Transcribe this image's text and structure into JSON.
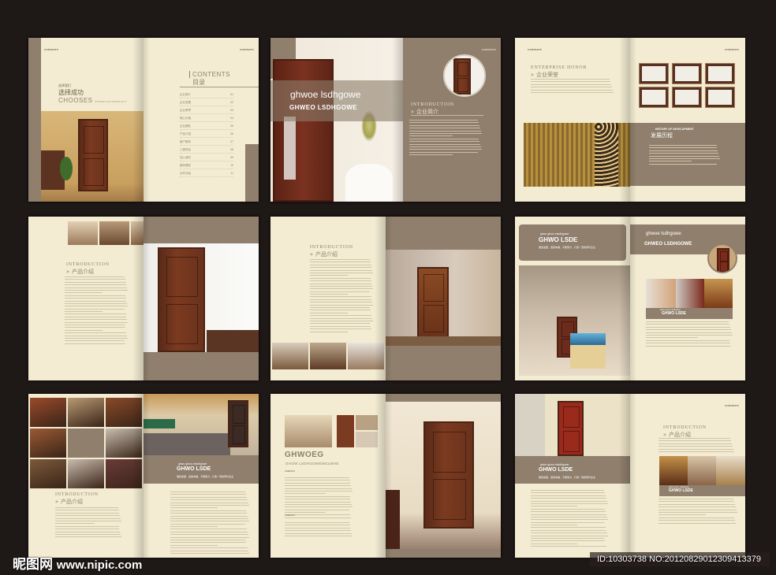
{
  "brand_small": "CONTENTS",
  "spread1": {
    "kicker": "选择我们",
    "title_cn": "选择成功",
    "title_en": "CHOOSES",
    "subtitle": "CHOSEN SUCCESSFULLY",
    "contents_en": "CONTENTS",
    "contents_cn": "目录",
    "toc": [
      {
        "label": "企业简介",
        "page": "01"
      },
      {
        "label": "企业发展",
        "page": "02"
      },
      {
        "label": "企业荣誉",
        "page": "03"
      },
      {
        "label": "核心价值",
        "page": "04"
      },
      {
        "label": "企业团队",
        "page": "05"
      },
      {
        "label": "产品介绍",
        "page": "06"
      },
      {
        "label": "客户服务",
        "page": "07"
      },
      {
        "label": "工程项目",
        "page": "08"
      },
      {
        "label": "加入我们",
        "page": "09"
      },
      {
        "label": "服务理念",
        "page": "10"
      },
      {
        "label": "合作共赢",
        "page": "11"
      }
    ]
  },
  "spread2": {
    "band_line1": "ghwoe lsdhgowe",
    "band_line2": "GHWEO LSDHGOWE",
    "heading_en": "INTRODUCTION",
    "heading_cn": "企业简介"
  },
  "spread3": {
    "heading_en": "ENTERPRISE HONOR",
    "heading_cn": "企业荣誉",
    "history_en": "HISTORY OF DEVELOPMENT",
    "history_cn": "发展历程"
  },
  "spread4": {
    "heading_en": "INTRODUCTION",
    "heading_cn": "产品介绍"
  },
  "spread5": {
    "heading_en": "INTRODUCTION",
    "heading_cn": "产品介绍"
  },
  "spread6": {
    "box_small": "ghwo ghwo mlsdhgowe",
    "box_title": "GHWO LSDE",
    "box_tagline": "邀您加盟，送贵本福，不断努力，打造一流的现代企业",
    "band_line1": "ghwoe lsdhgowe",
    "band_line2": "GHWEO LSDHGOWE",
    "caption_small": "ghwo ghwo mlsdhgowe",
    "caption_title": "GHWO LSDE",
    "caption_tagline": "邀您加盟，送贵本福，不断努力，打造一流的现代企业"
  },
  "spread7": {
    "heading_en": "INTRODUCTION",
    "heading_cn": "产品介绍",
    "band_small": "ghwo ghwo mlsdhgowe",
    "band_title": "GHWO LSDE",
    "band_tagline": "邀您加盟，送贵本福，不断努力，打造一流的现代企业"
  },
  "spread8": {
    "title": "GHWOEG",
    "subtitle": "GHOW LSDHGOWEMGLWHE",
    "section1": "GHWEOLS",
    "section2": "GHWEOLS"
  },
  "spread9": {
    "band_small": "ghwo ghwo mlsdhgowe",
    "band_title": "GHWO LSDE",
    "band_tagline": "邀您加盟，送贵本福，不断努力，打造一流的现代企业",
    "heading_en": "INTRODUCTION",
    "heading_cn": "产品介绍",
    "caption_small": "ghwo ghwo mlsdhgowe",
    "caption_title": "GHWO LSDE",
    "caption_tagline": "邀您加盟，送贵本福，不断努力，打造一流的现代企业"
  },
  "watermark": {
    "logo": "昵图网",
    "url": "www.nipic.com",
    "id": "ID:10303738 NO:20120829012309413379"
  },
  "colors": {
    "background": "#1e1816",
    "cream": "#f3ecd2",
    "brown": "#8f7f6c"
  }
}
